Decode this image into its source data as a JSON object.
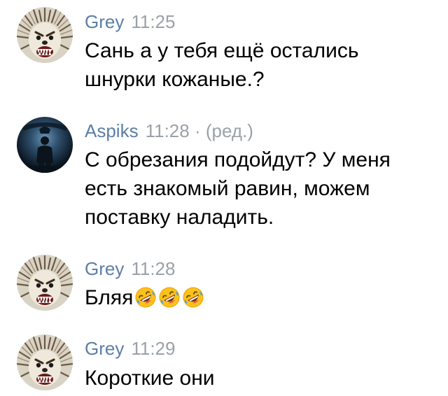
{
  "messages": [
    {
      "author": "Grey",
      "time": "11:25",
      "edited": "",
      "avatar_icon": "hedgehog-avatar-icon",
      "text": "Сань а у тебя ещё остались шнурки кожаные.?"
    },
    {
      "author": "Aspiks",
      "time": "11:28",
      "edited": "· (ред.)",
      "avatar_icon": "dark-figure-avatar-icon",
      "text": "С обрезания подойдут? У меня есть знакомый равин, можем поставку наладить."
    },
    {
      "author": "Grey",
      "time": "11:28",
      "edited": "",
      "avatar_icon": "hedgehog-avatar-icon",
      "text": "Бляя",
      "emojis": [
        "rolling-on-floor-laughing-emoji",
        "rolling-on-floor-laughing-emoji",
        "rolling-on-floor-laughing-emoji"
      ]
    },
    {
      "author": "Grey",
      "time": "11:29",
      "edited": "",
      "avatar_icon": "hedgehog-avatar-icon",
      "text": "Короткие они"
    }
  ],
  "colors": {
    "author": "#5b7fa6",
    "time": "#9aa1a9",
    "text": "#000000",
    "background": "#ffffff"
  }
}
